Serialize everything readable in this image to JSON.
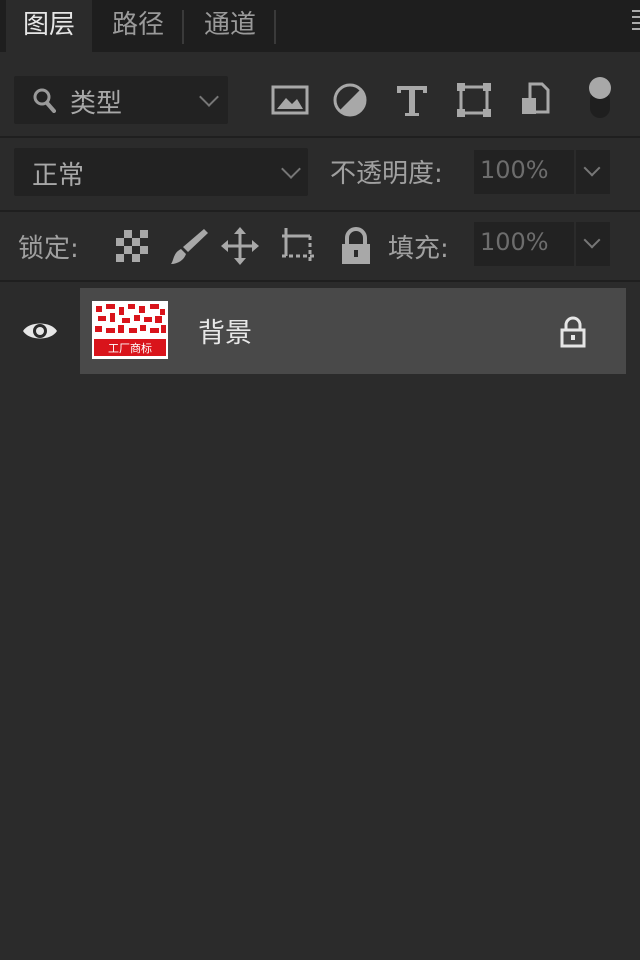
{
  "tabs": [
    {
      "label": "图层",
      "active": true
    },
    {
      "label": "路径",
      "active": false
    },
    {
      "label": "通道",
      "active": false
    }
  ],
  "filter": {
    "kind_label": "类型",
    "icons": [
      "image-filter-icon",
      "adjustment-filter-icon",
      "type-filter-icon",
      "shape-filter-icon",
      "smart-object-filter-icon",
      "filter-toggle-icon"
    ]
  },
  "blend": {
    "mode": "正常",
    "opacity_label": "不透明度:",
    "opacity_value": "100%"
  },
  "lock": {
    "label": "锁定:",
    "icons": [
      "lock-transparent-pixels-icon",
      "lock-image-pixels-icon",
      "lock-position-icon",
      "lock-artboard-icon",
      "lock-all-icon"
    ],
    "fill_label": "填充:",
    "fill_value": "100%"
  },
  "layers": [
    {
      "name": "背景",
      "visible": true,
      "locked": true,
      "thumb_caption": "工厂商标"
    }
  ],
  "colors": {
    "panel_bg": "#2b2b2b",
    "tabbar_bg": "#1e1e1e",
    "selected_layer_bg": "#494949",
    "thumb_red": "#d9141b"
  }
}
